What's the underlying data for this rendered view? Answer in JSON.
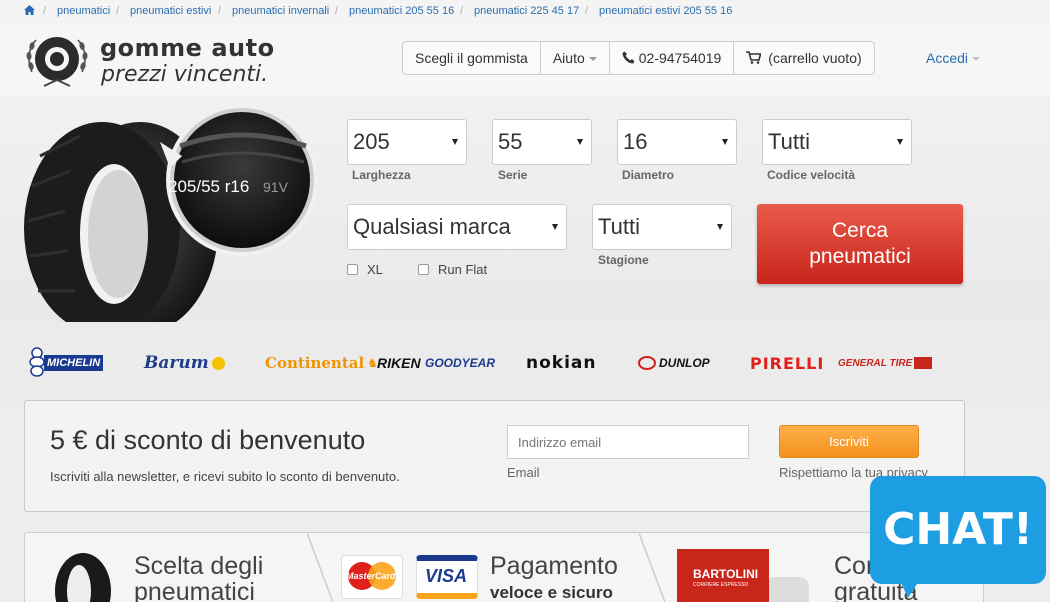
{
  "breadcrumb": {
    "home_icon": "home-icon",
    "items": [
      "pneumatici",
      "pneumatici estivi",
      "pneumatici invernali",
      "pneumatici 205 55 16",
      "pneumatici 225 45 17",
      "pneumatici estivi 205 55 16"
    ]
  },
  "logo": {
    "title": "gomme auto",
    "subtitle": "prezzi vincenti."
  },
  "topnav": {
    "gommista": "Scegli il gommista",
    "aiuto": "Aiuto",
    "phone_icon": "phone-icon",
    "phone": "02-94754019",
    "cart_icon": "cart-icon",
    "cart": "(carrello vuoto)",
    "accedi": "Accedi"
  },
  "search": {
    "tire_size_label": "205/55 r16",
    "tire_speed_label": "91V",
    "larghezza": {
      "value": "205",
      "label": "Larghezza"
    },
    "serie": {
      "value": "55",
      "label": "Serie"
    },
    "diametro": {
      "value": "16",
      "label": "Diametro"
    },
    "codice_velocita": {
      "value": "Tutti",
      "label": "Codice velocità"
    },
    "marca": {
      "value": "Qualsiasi marca"
    },
    "stagione": {
      "value": "Tutti",
      "label": "Stagione"
    },
    "xl_label": "XL",
    "runflat_label": "Run Flat",
    "button_line1": "Cerca",
    "button_line2": "pneumatici"
  },
  "brands": [
    "MICHELIN",
    "Barum",
    "Continental",
    "RIKEN",
    "GOODYEAR",
    "nokian",
    "DUNLOP",
    "PIRELLI",
    "GENERAL TIRE"
  ],
  "newsletter": {
    "title": "5 € di sconto di benvenuto",
    "description": "Iscriviti alla newsletter, e ricevi subito lo sconto di benvenuto.",
    "email_placeholder": "Indirizzo email",
    "email_label": "Email",
    "button": "Iscriviti",
    "privacy": "Rispettiamo la tua privacy"
  },
  "features": {
    "scelta_line1": "Scelta degli",
    "scelta_line2": "pneumatici",
    "mastercard": "MasterCard",
    "visa": "VISA",
    "pagamento_line1": "Pagamento",
    "pagamento_line2": "veloce e sicuro",
    "bartolini": "BARTOLINI",
    "bartolini_sub": "CORRIERE ESPRESSO",
    "consegna_line1": "Con",
    "consegna_line2": "gratuita"
  },
  "chat": {
    "label": "CHAT!"
  },
  "colors": {
    "link": "#2a6db0",
    "cta_red": "#c8251b",
    "cta_orange": "#f3901d",
    "chat_blue": "#1d9ee3"
  }
}
